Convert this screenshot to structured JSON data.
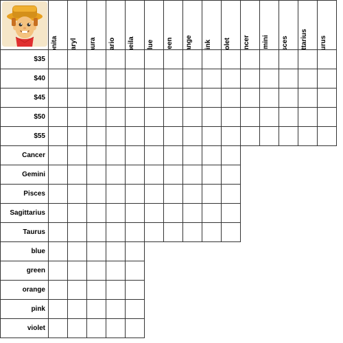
{
  "grid": {
    "col_headers": [
      "Bonita",
      "Daryl",
      "Laura",
      "Mario",
      "Sheila",
      "blue",
      "green",
      "orange",
      "pink",
      "violet",
      "Cancer",
      "Gemini",
      "Pisces",
      "Sagittarius",
      "Taurus"
    ],
    "row_headers": [
      "$35",
      "$40",
      "$45",
      "$50",
      "$55",
      "Cancer",
      "Gemini",
      "Pisces",
      "Sagittarius",
      "Taurus",
      "blue",
      "green",
      "orange",
      "pink",
      "violet"
    ],
    "avatar_label": "Bonita character"
  }
}
